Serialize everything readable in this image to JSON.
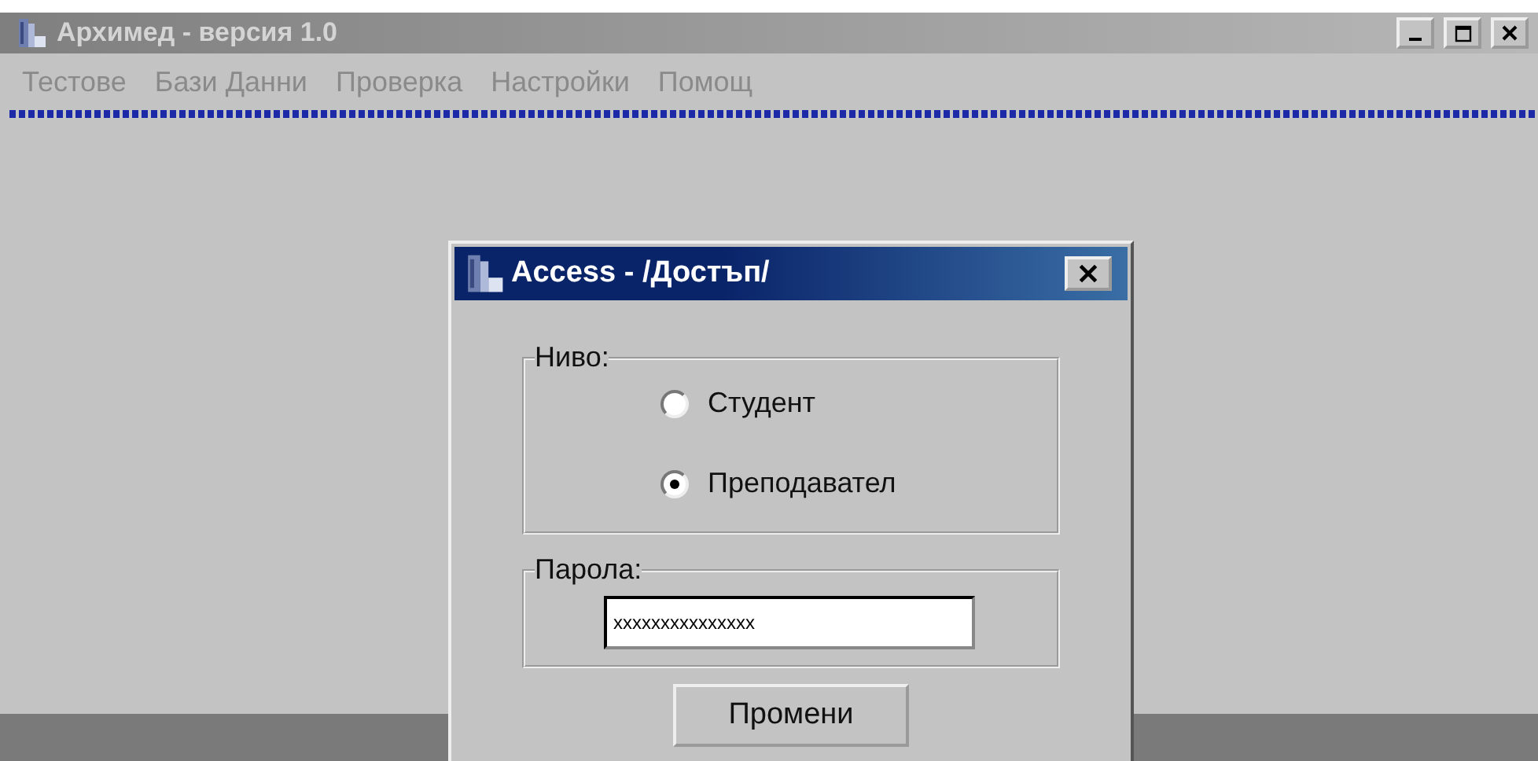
{
  "window": {
    "title": "Архимед - версия 1.0",
    "active": false
  },
  "title_buttons": [
    {
      "kind": "minimize"
    },
    {
      "kind": "maximize"
    },
    {
      "kind": "close"
    }
  ],
  "menu": [
    "Тестове",
    "Бази Данни",
    "Проверка",
    "Настройки",
    "Помощ"
  ],
  "dialog": {
    "title": "Access - /Достъп/",
    "active": true,
    "level_group": {
      "label": "Ниво:",
      "options": [
        {
          "label": "Студент",
          "selected": false
        },
        {
          "label": "Преподавател",
          "selected": true
        }
      ]
    },
    "password_group": {
      "label": "Парола:",
      "value": "xxxxxxxxxxxxxxx"
    },
    "button": "Промени"
  }
}
